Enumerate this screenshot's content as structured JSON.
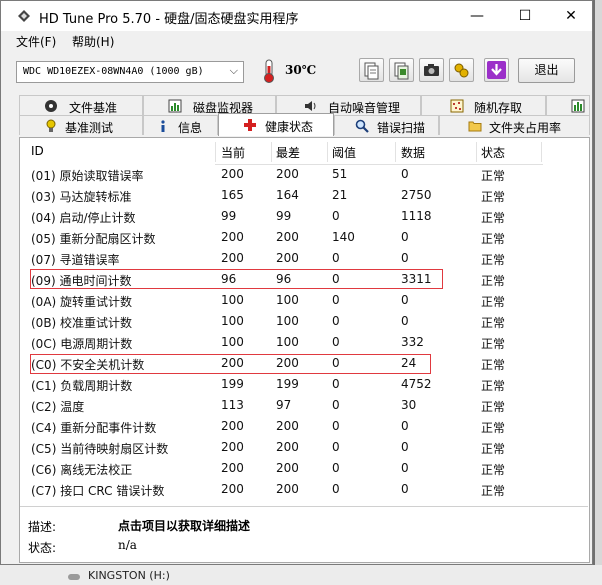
{
  "window": {
    "title": "HD Tune Pro 5.70 - 硬盘/固态硬盘实用程序",
    "minimize": "—",
    "maximize": "☐",
    "close": "✕"
  },
  "menu": {
    "file": "文件(F)",
    "help": "帮助(H)"
  },
  "toolbar": {
    "drive": "WDC WD10EZEX-08WN4A0 (1000 gB)",
    "drive_arrow": "⌵",
    "temperature": "30℃",
    "exit_label": "退出",
    "buttons": [
      "copy-text-icon",
      "copy-screenshot-icon",
      "camera-icon",
      "options-icon",
      "save-icon"
    ]
  },
  "tabs_top": [
    {
      "label": "文件基准",
      "icon": "file-benchmark-icon"
    },
    {
      "label": "磁盘监视器",
      "icon": "disk-monitor-icon"
    },
    {
      "label": "自动噪音管理",
      "icon": "speaker-icon"
    },
    {
      "label": "随机存取",
      "icon": "random-access-icon"
    },
    {
      "label": "",
      "icon": "extra-tests-icon"
    }
  ],
  "tabs_bottom": [
    {
      "label": "基准测试",
      "icon": "benchmark-icon"
    },
    {
      "label": "信息",
      "icon": "info-icon"
    },
    {
      "label": "健康状态",
      "icon": "health-cross-icon",
      "active": true
    },
    {
      "label": "错误扫描",
      "icon": "magnifier-icon"
    },
    {
      "label": "文件夹占用率",
      "icon": "folder-icon"
    }
  ],
  "table": {
    "columns": [
      "ID",
      "当前",
      "最差",
      "阈值",
      "数据",
      "状态"
    ],
    "rows": [
      [
        "(01) 原始读取错误率",
        "200",
        "200",
        "51",
        "0",
        "正常"
      ],
      [
        "(03) 马达旋转标准",
        "165",
        "164",
        "21",
        "2750",
        "正常"
      ],
      [
        "(04) 启动/停止计数",
        "99",
        "99",
        "0",
        "1118",
        "正常"
      ],
      [
        "(05) 重新分配扇区计数",
        "200",
        "200",
        "140",
        "0",
        "正常"
      ],
      [
        "(07) 寻道错误率",
        "200",
        "200",
        "0",
        "0",
        "正常"
      ],
      [
        "(09) 通电时间计数",
        "96",
        "96",
        "0",
        "3311",
        "正常"
      ],
      [
        "(0A) 旋转重试计数",
        "100",
        "100",
        "0",
        "0",
        "正常"
      ],
      [
        "(0B) 校准重试计数",
        "100",
        "100",
        "0",
        "0",
        "正常"
      ],
      [
        "(0C) 电源周期计数",
        "100",
        "100",
        "0",
        "332",
        "正常"
      ],
      [
        "(C0) 不安全关机计数",
        "200",
        "200",
        "0",
        "24",
        "正常"
      ],
      [
        "(C1) 负载周期计数",
        "199",
        "199",
        "0",
        "4752",
        "正常"
      ],
      [
        "(C2) 温度",
        "113",
        "97",
        "0",
        "30",
        "正常"
      ],
      [
        "(C4) 重新分配事件计数",
        "200",
        "200",
        "0",
        "0",
        "正常"
      ],
      [
        "(C5) 当前待映射扇区计数",
        "200",
        "200",
        "0",
        "0",
        "正常"
      ],
      [
        "(C6) 离线无法校正",
        "200",
        "200",
        "0",
        "0",
        "正常"
      ],
      [
        "(C7) 接口 CRC 错误计数",
        "200",
        "200",
        "0",
        "0",
        "正常"
      ]
    ]
  },
  "details": {
    "desc_label": "描述:",
    "desc_value": "点击项目以获取详细描述",
    "status_label": "状态:",
    "status_value": "n/a"
  },
  "background": {
    "drive_label": "KINGSTON (H:)"
  },
  "colors": {
    "highlight": "#e0393f",
    "header_bg": "#ffffff",
    "window_bg": "#f0f0f0"
  }
}
